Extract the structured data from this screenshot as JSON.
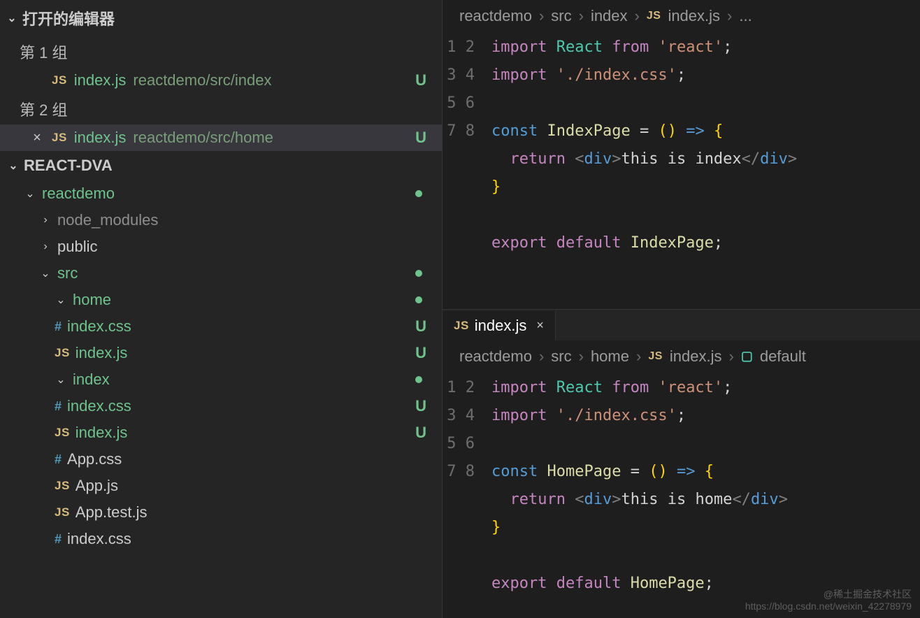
{
  "sidebar": {
    "open_editors_label": "打开的编辑器",
    "groups": [
      {
        "label": "第 1 组",
        "items": [
          {
            "icon": "JS",
            "name": "index.js",
            "path": "reactdemo/src/index",
            "status": "U",
            "active": false,
            "closeable": false
          }
        ]
      },
      {
        "label": "第 2 组",
        "items": [
          {
            "icon": "JS",
            "name": "index.js",
            "path": "reactdemo/src/home",
            "status": "U",
            "active": true,
            "closeable": true
          }
        ]
      }
    ],
    "project_name": "REACT-DVA",
    "tree": [
      {
        "depth": 1,
        "chevron": "down",
        "label": "reactdemo",
        "green": true,
        "dot": true
      },
      {
        "depth": 2,
        "chevron": "right",
        "label": "node_modules",
        "gray": true
      },
      {
        "depth": 2,
        "chevron": "right",
        "label": "public"
      },
      {
        "depth": 2,
        "chevron": "down",
        "label": "src",
        "green": true,
        "dot": true
      },
      {
        "depth": 3,
        "chevron": "down",
        "label": "home",
        "green": true,
        "dot": true
      },
      {
        "depth": 4,
        "icon": "#",
        "label": "index.css",
        "green": true,
        "status": "U"
      },
      {
        "depth": 4,
        "icon": "JS",
        "label": "index.js",
        "green": true,
        "status": "U"
      },
      {
        "depth": 3,
        "chevron": "down",
        "label": "index",
        "green": true,
        "dot": true
      },
      {
        "depth": 4,
        "icon": "#",
        "label": "index.css",
        "green": true,
        "status": "U"
      },
      {
        "depth": 4,
        "icon": "JS",
        "label": "index.js",
        "green": true,
        "status": "U"
      },
      {
        "depth": 3,
        "icon": "#",
        "label": "App.css"
      },
      {
        "depth": 3,
        "icon": "JS",
        "label": "App.js"
      },
      {
        "depth": 3,
        "icon": "JS",
        "label": "App.test.js"
      },
      {
        "depth": 3,
        "icon": "#",
        "label": "index.css",
        "cut": true
      }
    ]
  },
  "editors": [
    {
      "tab": null,
      "breadcrumb": [
        "reactdemo",
        "src",
        "index",
        {
          "icon": "JS",
          "text": "index.js"
        },
        "..."
      ],
      "lines": [
        [
          {
            "t": "kw",
            "v": "import"
          },
          {
            "t": "sp"
          },
          {
            "t": "type",
            "v": "React"
          },
          {
            "t": "sp"
          },
          {
            "t": "kw",
            "v": "from"
          },
          {
            "t": "sp"
          },
          {
            "t": "str",
            "v": "'react'"
          },
          {
            "t": "op",
            "v": ";"
          }
        ],
        [
          {
            "t": "kw",
            "v": "import"
          },
          {
            "t": "sp"
          },
          {
            "t": "str",
            "v": "'./index.css'"
          },
          {
            "t": "op",
            "v": ";"
          }
        ],
        [],
        [
          {
            "t": "fn",
            "v": "const"
          },
          {
            "t": "sp"
          },
          {
            "t": "var",
            "v": "IndexPage"
          },
          {
            "t": "sp"
          },
          {
            "t": "op",
            "v": "="
          },
          {
            "t": "sp"
          },
          {
            "t": "brace",
            "v": "("
          },
          {
            "t": "brace",
            "v": ")"
          },
          {
            "t": "sp"
          },
          {
            "t": "fn",
            "v": "=>"
          },
          {
            "t": "sp"
          },
          {
            "t": "brace",
            "v": "{"
          }
        ],
        [
          {
            "t": "indent"
          },
          {
            "t": "kw",
            "v": "return"
          },
          {
            "t": "sp"
          },
          {
            "t": "punct",
            "v": "<"
          },
          {
            "t": "tag",
            "v": "div"
          },
          {
            "t": "punct",
            "v": ">"
          },
          {
            "t": "txt",
            "v": "this is index"
          },
          {
            "t": "punct",
            "v": "</"
          },
          {
            "t": "tag",
            "v": "div"
          },
          {
            "t": "punct",
            "v": ">"
          }
        ],
        [
          {
            "t": "brace",
            "v": "}"
          }
        ],
        [],
        [
          {
            "t": "kw",
            "v": "export"
          },
          {
            "t": "sp"
          },
          {
            "t": "kw",
            "v": "default"
          },
          {
            "t": "sp"
          },
          {
            "t": "var",
            "v": "IndexPage"
          },
          {
            "t": "op",
            "v": ";"
          }
        ]
      ]
    },
    {
      "tab": {
        "icon": "JS",
        "name": "index.js"
      },
      "breadcrumb": [
        "reactdemo",
        "src",
        "home",
        {
          "icon": "JS",
          "text": "index.js"
        },
        {
          "icon": "sym",
          "text": "default"
        }
      ],
      "lines": [
        [
          {
            "t": "kw",
            "v": "import"
          },
          {
            "t": "sp"
          },
          {
            "t": "type",
            "v": "React"
          },
          {
            "t": "sp"
          },
          {
            "t": "kw",
            "v": "from"
          },
          {
            "t": "sp"
          },
          {
            "t": "str",
            "v": "'react'"
          },
          {
            "t": "op",
            "v": ";"
          }
        ],
        [
          {
            "t": "kw",
            "v": "import"
          },
          {
            "t": "sp"
          },
          {
            "t": "str",
            "v": "'./index.css'"
          },
          {
            "t": "op",
            "v": ";"
          }
        ],
        [],
        [
          {
            "t": "fn",
            "v": "const"
          },
          {
            "t": "sp"
          },
          {
            "t": "var",
            "v": "HomePage"
          },
          {
            "t": "sp"
          },
          {
            "t": "op",
            "v": "="
          },
          {
            "t": "sp"
          },
          {
            "t": "brace",
            "v": "("
          },
          {
            "t": "brace",
            "v": ")"
          },
          {
            "t": "sp"
          },
          {
            "t": "fn",
            "v": "=>"
          },
          {
            "t": "sp"
          },
          {
            "t": "brace",
            "v": "{"
          }
        ],
        [
          {
            "t": "indent"
          },
          {
            "t": "kw",
            "v": "return"
          },
          {
            "t": "sp"
          },
          {
            "t": "punct",
            "v": "<"
          },
          {
            "t": "tag",
            "v": "div"
          },
          {
            "t": "punct",
            "v": ">"
          },
          {
            "t": "txt",
            "v": "this is home"
          },
          {
            "t": "punct",
            "v": "</"
          },
          {
            "t": "tag",
            "v": "div"
          },
          {
            "t": "punct",
            "v": ">"
          }
        ],
        [
          {
            "t": "brace",
            "v": "}"
          }
        ],
        [],
        [
          {
            "t": "kw",
            "v": "export"
          },
          {
            "t": "sp"
          },
          {
            "t": "kw",
            "v": "default"
          },
          {
            "t": "sp"
          },
          {
            "t": "var",
            "v": "HomePage"
          },
          {
            "t": "op",
            "v": ";"
          }
        ]
      ]
    }
  ],
  "watermark": {
    "line1": "@稀土掘金技术社区",
    "line2": "https://blog.csdn.net/weixin_42278979"
  }
}
